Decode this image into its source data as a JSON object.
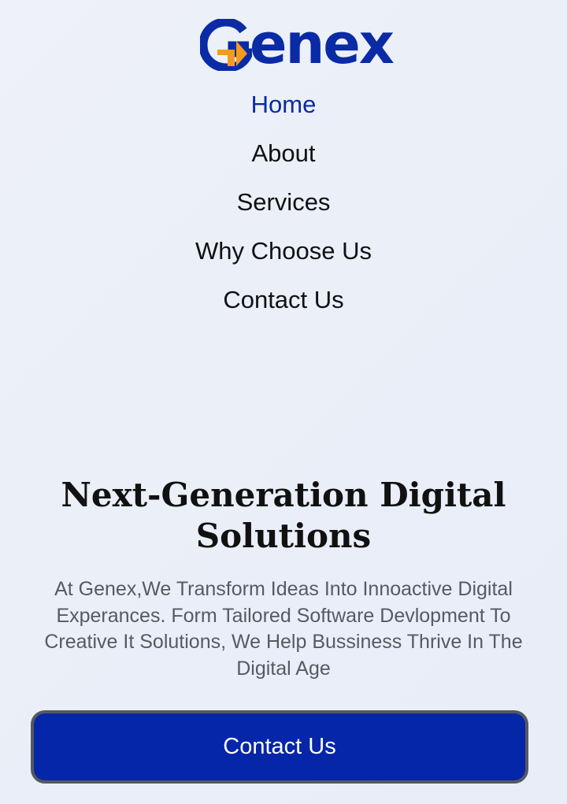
{
  "brand": {
    "name": "Genex",
    "logo_mark": "G-arrow-logo",
    "logo_text": "enex",
    "colors": {
      "primary": "#0B2AA6",
      "accent": "#F39A1F",
      "background": "#EDF1F8"
    }
  },
  "nav": {
    "items": [
      {
        "label": "Home",
        "active": true
      },
      {
        "label": "About",
        "active": false
      },
      {
        "label": "Services",
        "active": false
      },
      {
        "label": "Why Choose Us",
        "active": false
      },
      {
        "label": "Contact Us",
        "active": false
      }
    ]
  },
  "hero": {
    "title_line1": "Next-Generation Digital",
    "title_line2": "Solutions",
    "description": "At Genex,We Transform Ideas Into Innoactive Digital Experances. Form Tailored Software Devlopment To Creative It Solutions, We Help Bussiness Thrive In The Digital Age",
    "cta_label": "Contact Us"
  }
}
